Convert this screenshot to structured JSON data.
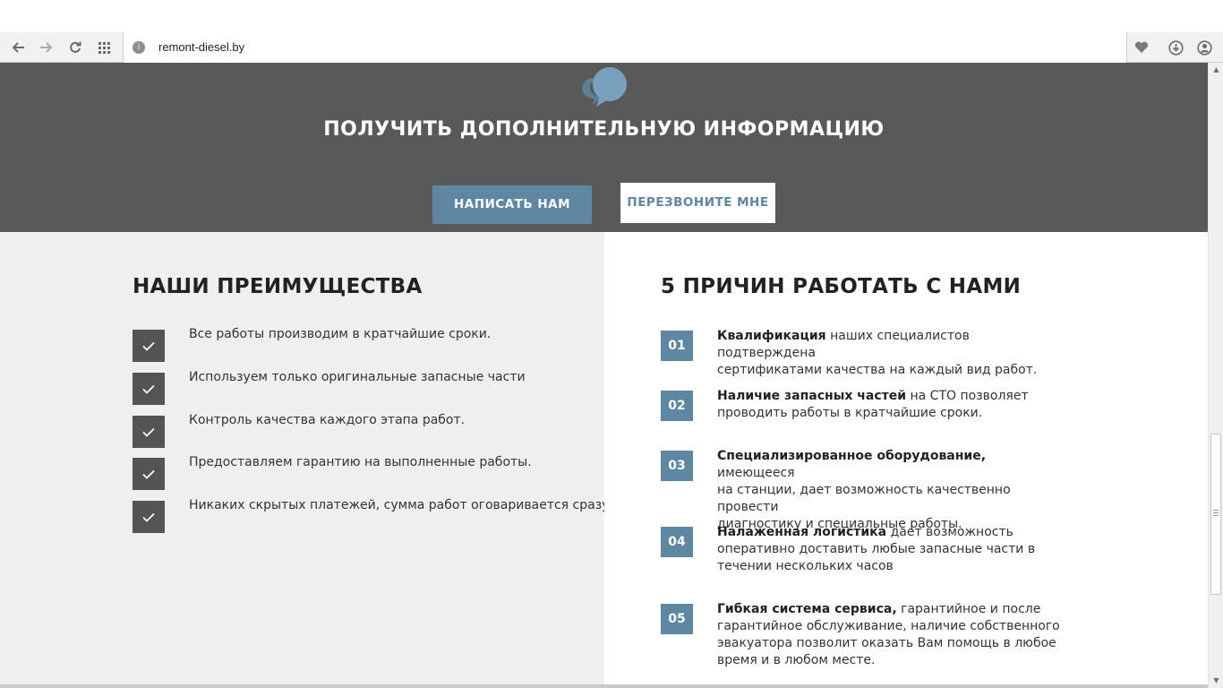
{
  "browser": {
    "url": "remont-diesel.by",
    "nav_icons": [
      "back-arrow-icon",
      "forward-arrow-icon",
      "reload-icon",
      "apps-grid-icon"
    ],
    "right_icons": [
      "heart-icon",
      "download-icon",
      "profile-icon"
    ]
  },
  "info": {
    "title": "ПОЛУЧИТЬ ДОПОЛНИТЕЛЬНУЮ ИНФОРМАЦИЮ",
    "write_button": "НАПИСАТЬ НАМ",
    "call_button": "ПЕРЕЗВОНИТЕ МНЕ",
    "icon": "chat-bubbles-icon"
  },
  "advantages": {
    "title": "НАШИ ПРЕИМУЩЕСТВА",
    "items": [
      "Все работы производим в кратчайшие сроки.",
      "Используем только оригинальные запасные части",
      "Контроль качества каждого этапа работ.",
      "Предоставляем гарантию на выполненные работы.",
      "Никаких скрытых платежей, сумма работ оговаривается сразу."
    ]
  },
  "reasons": {
    "title": "5 ПРИЧИН РАБОТАТЬ С НАМИ",
    "items": [
      {
        "num": "01",
        "bold": "Квалификация",
        "line1": " наших специалистов подтверждена",
        "line2": "сертификатами качества на каждый вид работ.",
        "line3": ""
      },
      {
        "num": "02",
        "bold": "Наличие запасных частей",
        "line1": " на СТО позволяет",
        "line2": "проводить работы в кратчайшие сроки.",
        "line3": ""
      },
      {
        "num": "03",
        "bold": "Специализированное оборудование,",
        "line1": " имеющееся",
        "line2": "на станции, дает возможность качественно провести",
        "line3": "диагностику и специальные работы."
      },
      {
        "num": "04",
        "bold": "Налаженная логистика",
        "line1": " дает возможность",
        "line2": "оперативно доставить любые запасные части в",
        "line3": "течении нескольких часов"
      },
      {
        "num": "05",
        "bold": "Гибкая система сервиса,",
        "line1": " гарантийное и после",
        "line2": "гарантийное обслуживание, наличие собственного",
        "line3": "эвакуатора позволит оказать Вам помощь в любое",
        "line4": "время и в любом месте."
      }
    ]
  },
  "colors": {
    "accent": "#5e87a3",
    "dark_band": "#595959",
    "check_box": "#545454",
    "left_bg": "#efeff0"
  }
}
